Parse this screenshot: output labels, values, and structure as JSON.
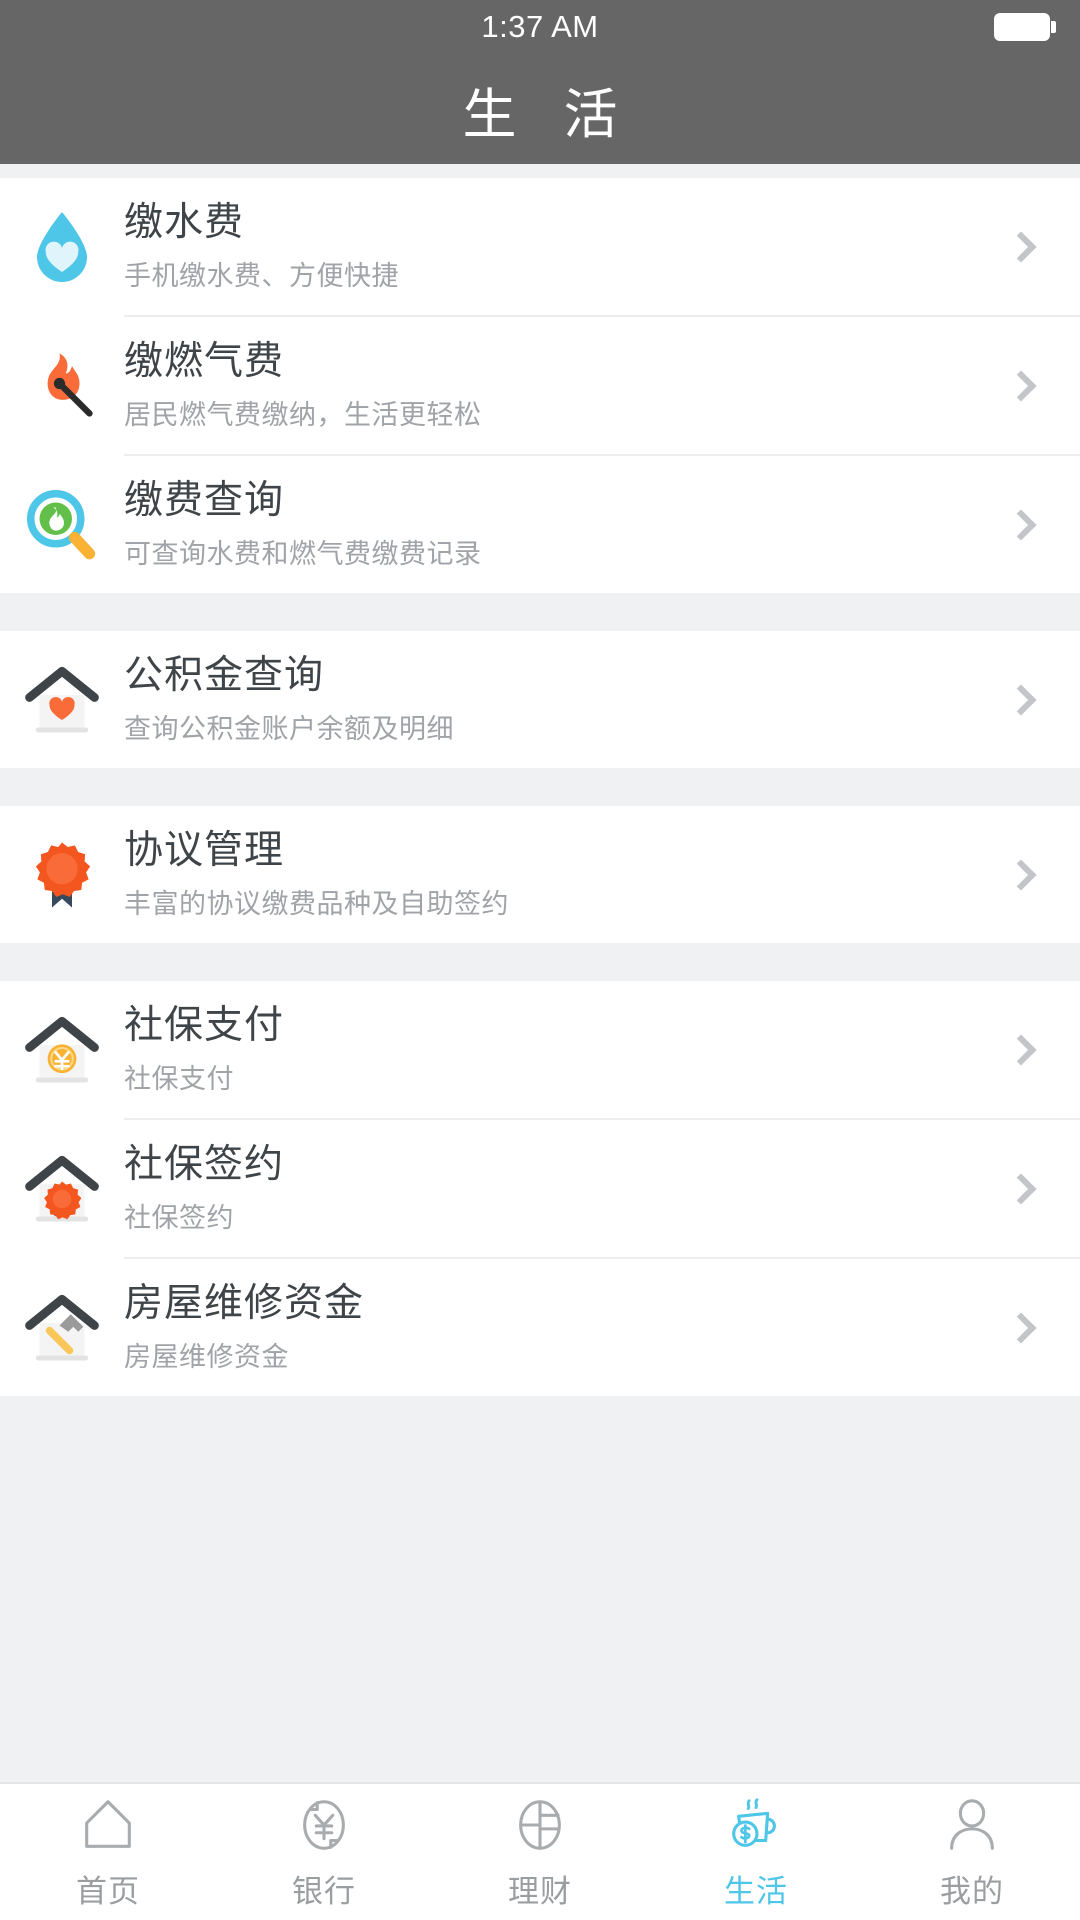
{
  "status": {
    "time": "1:37 AM",
    "battery_icon": "battery-full-icon"
  },
  "header": {
    "title": "生 活"
  },
  "colors": {
    "header_bg": "#666666",
    "page_bg": "#f0f1f3",
    "accent": "#4ec6e8",
    "title_text": "#3e4448",
    "subtitle_text": "#a0a3a7",
    "chevron": "#c3c5c9",
    "orange": "#f96c39",
    "water_cyan": "#4ec6e8",
    "green": "#62bf4a",
    "yellow": "#f9b233",
    "navy": "#37495c"
  },
  "groups": [
    {
      "id": "utilities",
      "items": [
        {
          "title": "缴水费",
          "subtitle": "手机缴水费、方便快捷",
          "icon": "water-drop-heart-icon",
          "chevron": "chevron-right-icon"
        },
        {
          "title": "缴燃气费",
          "subtitle": "居民燃气费缴纳，生活更轻松",
          "icon": "flame-match-icon",
          "chevron": "chevron-right-icon"
        },
        {
          "title": "缴费查询",
          "subtitle": "可查询水费和燃气费缴费记录",
          "icon": "magnifier-drop-icon",
          "chevron": "chevron-right-icon"
        }
      ]
    },
    {
      "id": "housing-fund",
      "items": [
        {
          "title": "公积金查询",
          "subtitle": "查询公积金账户余额及明细",
          "icon": "house-heart-icon",
          "chevron": "chevron-right-icon"
        }
      ]
    },
    {
      "id": "agreements",
      "items": [
        {
          "title": "协议管理",
          "subtitle": "丰富的协议缴费品种及自助签约",
          "icon": "rosette-ribbon-icon",
          "chevron": "chevron-right-icon"
        }
      ]
    },
    {
      "id": "social-security",
      "items": [
        {
          "title": "社保支付",
          "subtitle": "社保支付",
          "icon": "house-yen-coin-icon",
          "chevron": "chevron-right-icon"
        },
        {
          "title": "社保签约",
          "subtitle": "社保签约",
          "icon": "house-rosette-icon",
          "chevron": "chevron-right-icon"
        },
        {
          "title": "房屋维修资金",
          "subtitle": "房屋维修资金",
          "icon": "house-hammer-icon",
          "chevron": "chevron-right-icon"
        }
      ]
    }
  ],
  "tabbar": {
    "active_index": 3,
    "tabs": [
      {
        "label": "首页",
        "icon": "home-outline-icon"
      },
      {
        "label": "银行",
        "icon": "yen-exchange-icon"
      },
      {
        "label": "理财",
        "icon": "pie-chart-icon"
      },
      {
        "label": "生活",
        "icon": "coffee-cup-money-icon"
      },
      {
        "label": "我的",
        "icon": "person-outline-icon"
      }
    ]
  }
}
